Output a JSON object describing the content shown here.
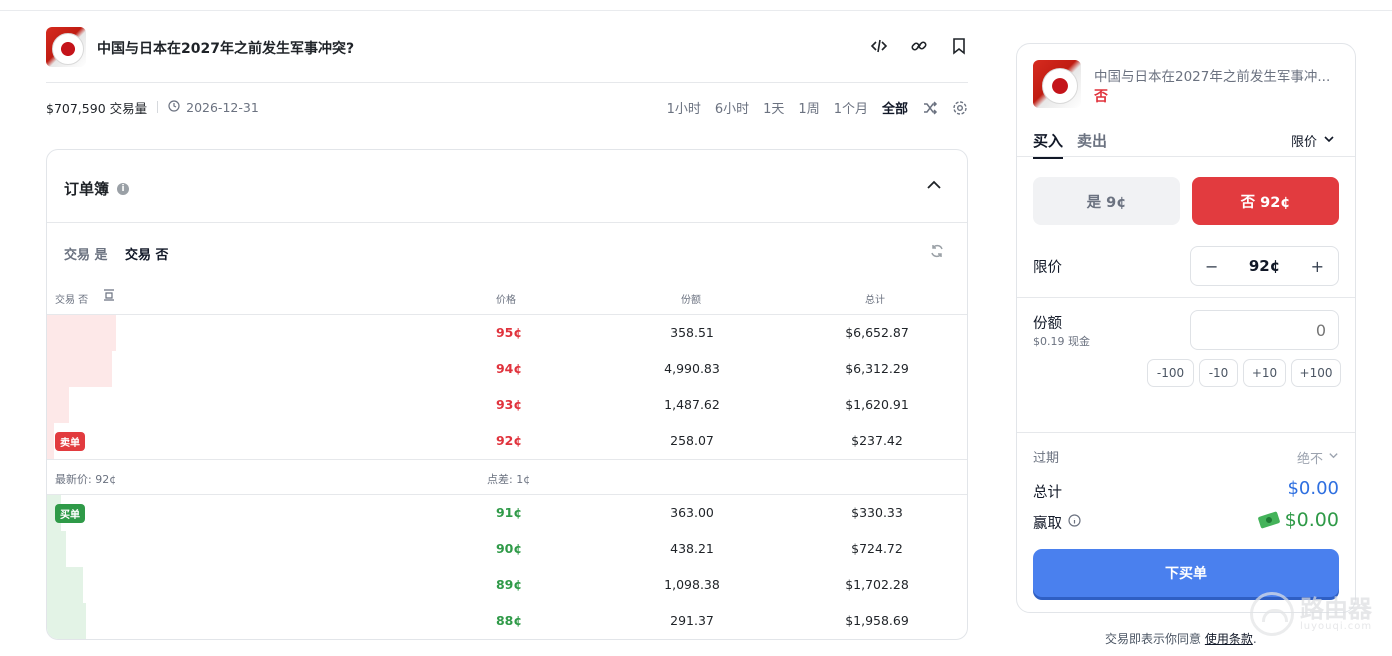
{
  "market": {
    "title": "中国与日本在2027年之前发生军事冲突?",
    "volume": "$707,590 交易量",
    "end_date": "2026-12-31",
    "ranges": [
      "1小时",
      "6小时",
      "1天",
      "1周",
      "1个月",
      "全部"
    ],
    "selected_range": "全部"
  },
  "orderbook": {
    "title": "订单簿",
    "trade_yes": "交易 是",
    "trade_no": "交易 否",
    "col_side": "交易 否",
    "col_price": "价格",
    "col_shares": "份额",
    "col_total": "总计",
    "asks": [
      {
        "price": "95¢",
        "shares": "358.51",
        "total": "$6,652.87",
        "depth": 0.075
      },
      {
        "price": "94¢",
        "shares": "4,990.83",
        "total": "$6,312.29",
        "depth": 0.071
      },
      {
        "price": "93¢",
        "shares": "1,487.62",
        "total": "$1,620.91",
        "depth": 0.024
      },
      {
        "price": "92¢",
        "shares": "258.07",
        "total": "$237.42",
        "depth": 0.008
      }
    ],
    "ask_label": "卖单",
    "last_price": "最新价: 92¢",
    "spread": "点差: 1¢",
    "bid_label": "买单",
    "bids": [
      {
        "price": "91¢",
        "shares": "363.00",
        "total": "$330.33",
        "depth": 0.015
      },
      {
        "price": "90¢",
        "shares": "438.21",
        "total": "$724.72",
        "depth": 0.021
      },
      {
        "price": "89¢",
        "shares": "1,098.38",
        "total": "$1,702.28",
        "depth": 0.039
      },
      {
        "price": "88¢",
        "shares": "291.37",
        "total": "$1,958.69",
        "depth": 0.042
      }
    ]
  },
  "panel": {
    "title": "中国与日本在2027年之前发生军事冲...",
    "side": "否",
    "tab_buy": "买入",
    "tab_sell": "卖出",
    "order_type": "限价",
    "yes_btn": "是 9¢",
    "no_btn": "否 92¢",
    "limit_label": "限价",
    "limit_value": "92¢",
    "shares_label": "份额",
    "cash": "$0.19 现金",
    "shares_placeholder": "0",
    "quick": [
      "-100",
      "-10",
      "+10",
      "+100"
    ],
    "expiry_label": "过期",
    "expiry_value": "绝不",
    "total_label": "总计",
    "total_value": "$0.00",
    "win_label": "赢取",
    "win_value": "$0.00",
    "order_button": "下买单"
  },
  "footer": {
    "terms_prefix": "交易即表示你同意",
    "terms_link": "使用条款",
    "terms_suffix": "."
  },
  "watermark": {
    "text": "路由器",
    "sub": "luyouqi.com"
  },
  "colors": {
    "red": "#e23b3f",
    "green": "#2f9a48",
    "blue": "#4a80ee"
  }
}
